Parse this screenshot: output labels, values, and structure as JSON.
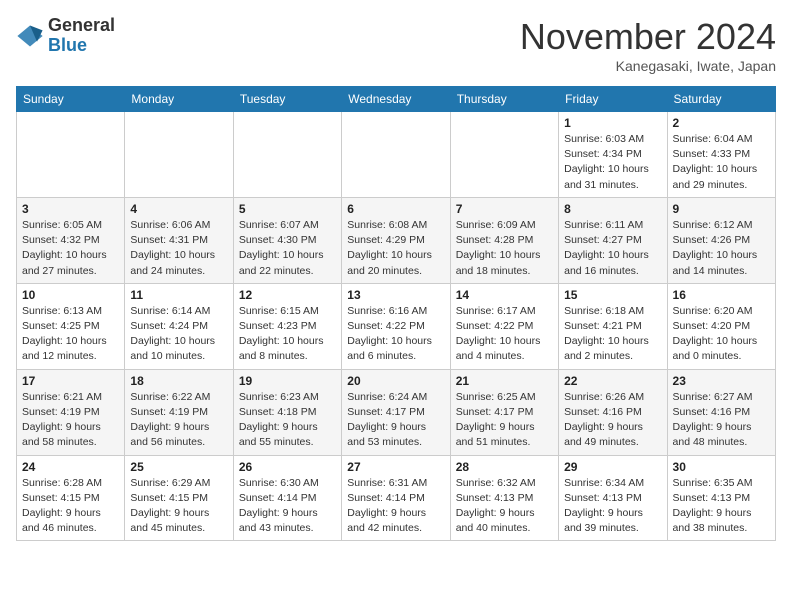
{
  "header": {
    "logo_line1": "General",
    "logo_line2": "Blue",
    "month": "November 2024",
    "location": "Kanegasaki, Iwate, Japan"
  },
  "weekdays": [
    "Sunday",
    "Monday",
    "Tuesday",
    "Wednesday",
    "Thursday",
    "Friday",
    "Saturday"
  ],
  "weeks": [
    [
      {
        "day": "",
        "info": ""
      },
      {
        "day": "",
        "info": ""
      },
      {
        "day": "",
        "info": ""
      },
      {
        "day": "",
        "info": ""
      },
      {
        "day": "",
        "info": ""
      },
      {
        "day": "1",
        "info": "Sunrise: 6:03 AM\nSunset: 4:34 PM\nDaylight: 10 hours\nand 31 minutes."
      },
      {
        "day": "2",
        "info": "Sunrise: 6:04 AM\nSunset: 4:33 PM\nDaylight: 10 hours\nand 29 minutes."
      }
    ],
    [
      {
        "day": "3",
        "info": "Sunrise: 6:05 AM\nSunset: 4:32 PM\nDaylight: 10 hours\nand 27 minutes."
      },
      {
        "day": "4",
        "info": "Sunrise: 6:06 AM\nSunset: 4:31 PM\nDaylight: 10 hours\nand 24 minutes."
      },
      {
        "day": "5",
        "info": "Sunrise: 6:07 AM\nSunset: 4:30 PM\nDaylight: 10 hours\nand 22 minutes."
      },
      {
        "day": "6",
        "info": "Sunrise: 6:08 AM\nSunset: 4:29 PM\nDaylight: 10 hours\nand 20 minutes."
      },
      {
        "day": "7",
        "info": "Sunrise: 6:09 AM\nSunset: 4:28 PM\nDaylight: 10 hours\nand 18 minutes."
      },
      {
        "day": "8",
        "info": "Sunrise: 6:11 AM\nSunset: 4:27 PM\nDaylight: 10 hours\nand 16 minutes."
      },
      {
        "day": "9",
        "info": "Sunrise: 6:12 AM\nSunset: 4:26 PM\nDaylight: 10 hours\nand 14 minutes."
      }
    ],
    [
      {
        "day": "10",
        "info": "Sunrise: 6:13 AM\nSunset: 4:25 PM\nDaylight: 10 hours\nand 12 minutes."
      },
      {
        "day": "11",
        "info": "Sunrise: 6:14 AM\nSunset: 4:24 PM\nDaylight: 10 hours\nand 10 minutes."
      },
      {
        "day": "12",
        "info": "Sunrise: 6:15 AM\nSunset: 4:23 PM\nDaylight: 10 hours\nand 8 minutes."
      },
      {
        "day": "13",
        "info": "Sunrise: 6:16 AM\nSunset: 4:22 PM\nDaylight: 10 hours\nand 6 minutes."
      },
      {
        "day": "14",
        "info": "Sunrise: 6:17 AM\nSunset: 4:22 PM\nDaylight: 10 hours\nand 4 minutes."
      },
      {
        "day": "15",
        "info": "Sunrise: 6:18 AM\nSunset: 4:21 PM\nDaylight: 10 hours\nand 2 minutes."
      },
      {
        "day": "16",
        "info": "Sunrise: 6:20 AM\nSunset: 4:20 PM\nDaylight: 10 hours\nand 0 minutes."
      }
    ],
    [
      {
        "day": "17",
        "info": "Sunrise: 6:21 AM\nSunset: 4:19 PM\nDaylight: 9 hours\nand 58 minutes."
      },
      {
        "day": "18",
        "info": "Sunrise: 6:22 AM\nSunset: 4:19 PM\nDaylight: 9 hours\nand 56 minutes."
      },
      {
        "day": "19",
        "info": "Sunrise: 6:23 AM\nSunset: 4:18 PM\nDaylight: 9 hours\nand 55 minutes."
      },
      {
        "day": "20",
        "info": "Sunrise: 6:24 AM\nSunset: 4:17 PM\nDaylight: 9 hours\nand 53 minutes."
      },
      {
        "day": "21",
        "info": "Sunrise: 6:25 AM\nSunset: 4:17 PM\nDaylight: 9 hours\nand 51 minutes."
      },
      {
        "day": "22",
        "info": "Sunrise: 6:26 AM\nSunset: 4:16 PM\nDaylight: 9 hours\nand 49 minutes."
      },
      {
        "day": "23",
        "info": "Sunrise: 6:27 AM\nSunset: 4:16 PM\nDaylight: 9 hours\nand 48 minutes."
      }
    ],
    [
      {
        "day": "24",
        "info": "Sunrise: 6:28 AM\nSunset: 4:15 PM\nDaylight: 9 hours\nand 46 minutes."
      },
      {
        "day": "25",
        "info": "Sunrise: 6:29 AM\nSunset: 4:15 PM\nDaylight: 9 hours\nand 45 minutes."
      },
      {
        "day": "26",
        "info": "Sunrise: 6:30 AM\nSunset: 4:14 PM\nDaylight: 9 hours\nand 43 minutes."
      },
      {
        "day": "27",
        "info": "Sunrise: 6:31 AM\nSunset: 4:14 PM\nDaylight: 9 hours\nand 42 minutes."
      },
      {
        "day": "28",
        "info": "Sunrise: 6:32 AM\nSunset: 4:13 PM\nDaylight: 9 hours\nand 40 minutes."
      },
      {
        "day": "29",
        "info": "Sunrise: 6:34 AM\nSunset: 4:13 PM\nDaylight: 9 hours\nand 39 minutes."
      },
      {
        "day": "30",
        "info": "Sunrise: 6:35 AM\nSunset: 4:13 PM\nDaylight: 9 hours\nand 38 minutes."
      }
    ]
  ]
}
